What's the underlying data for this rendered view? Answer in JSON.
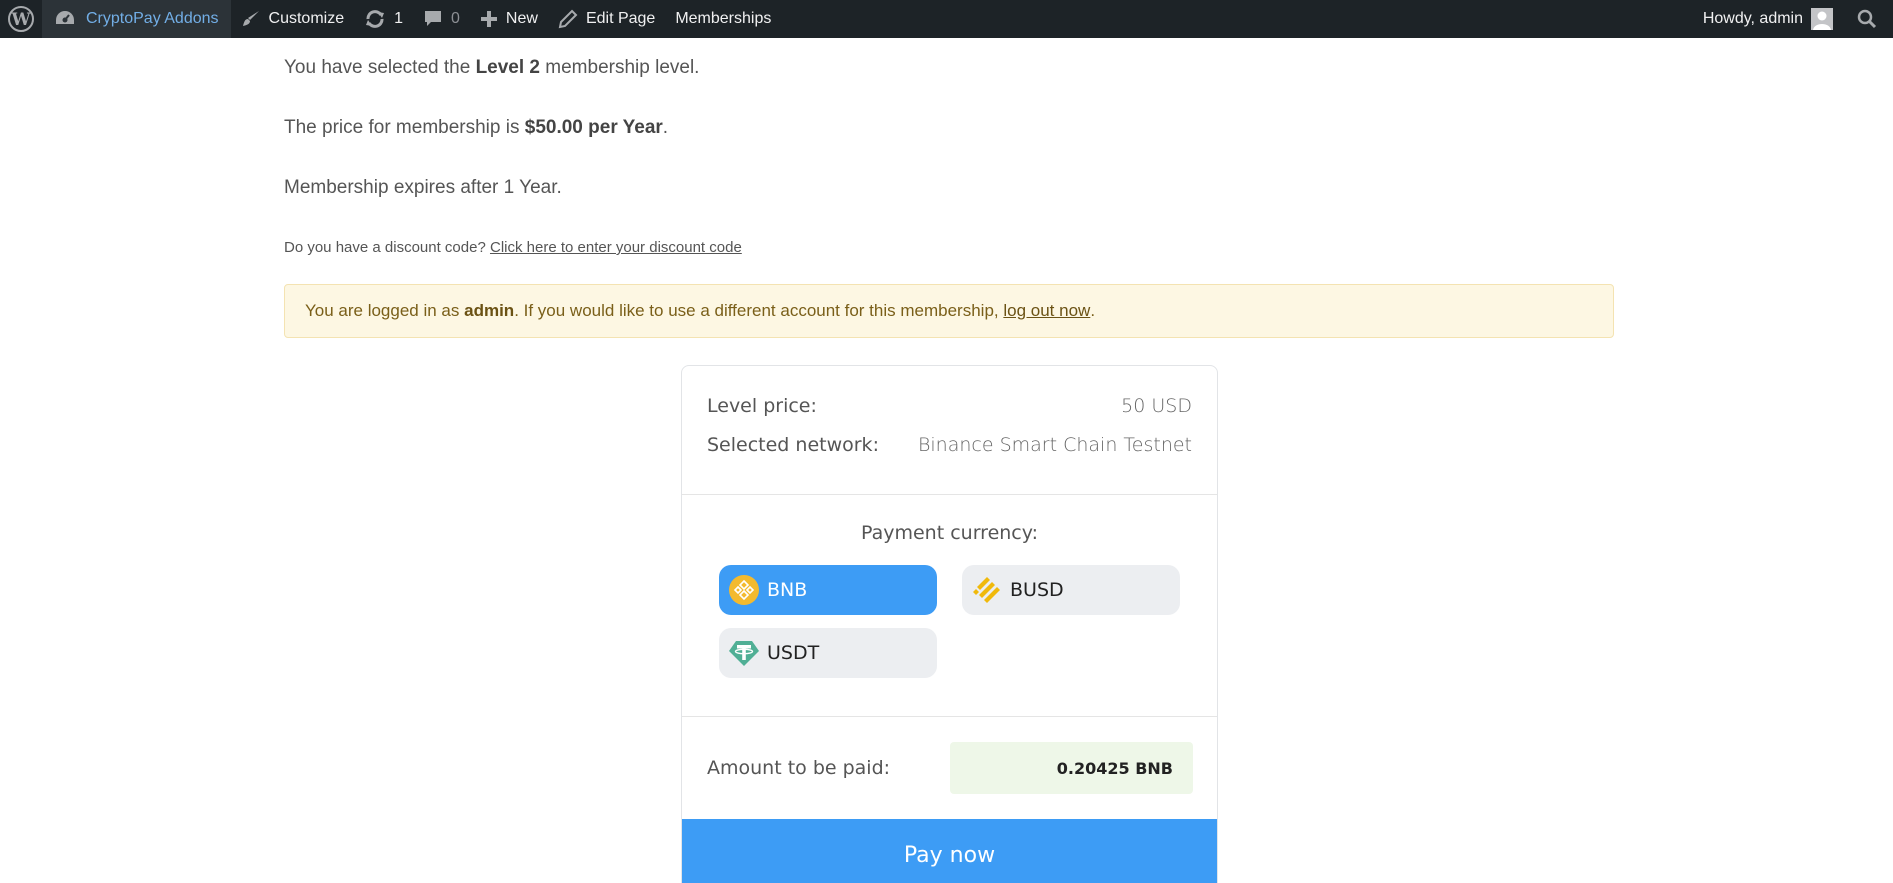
{
  "admin_bar": {
    "site_name": "CryptoPay Addons",
    "customize": "Customize",
    "updates_count": "1",
    "comments_count": "0",
    "new": "New",
    "edit_page": "Edit Page",
    "memberships": "Memberships",
    "howdy": "Howdy, admin",
    "icons": [
      "wordpress-logo-icon",
      "dashboard-icon",
      "brush-icon",
      "updates-icon",
      "comment-icon",
      "plus-icon",
      "pencil-icon",
      "avatar",
      "search-icon"
    ]
  },
  "checkout": {
    "level_prefix": "You have selected the ",
    "level_name": "Level 2",
    "level_suffix": " membership level.",
    "price_prefix": "The price for membership is ",
    "price_value": "$50.00 per Year",
    "price_suffix": ".",
    "expires": "Membership expires after 1 Year.",
    "discount_question": "Do you have a discount code? ",
    "discount_link": "Click here to enter your discount code"
  },
  "notice": {
    "prefix": "You are logged in as ",
    "username": "admin",
    "middle": ". If you would like to use a different account for this membership, ",
    "logout_link": "log out now",
    "suffix": ".",
    "background": "#fdf7e3",
    "text_color": "#7a5f19"
  },
  "payment_card": {
    "level_price_label": "Level price:",
    "level_price_value": "50 USD",
    "network_label": "Selected network:",
    "network_value": "Binance Smart Chain Testnet",
    "currency_title": "Payment currency:",
    "currencies": [
      {
        "symbol": "BNB",
        "icon": "bnb-icon",
        "selected": true
      },
      {
        "symbol": "BUSD",
        "icon": "busd-icon",
        "selected": false
      },
      {
        "symbol": "USDT",
        "icon": "usdt-icon",
        "selected": false
      }
    ],
    "amount_label": "Amount to be paid:",
    "amount_value": "0.20425 BNB",
    "pay_button": "Pay now",
    "accent_color": "#3d9cf5"
  }
}
